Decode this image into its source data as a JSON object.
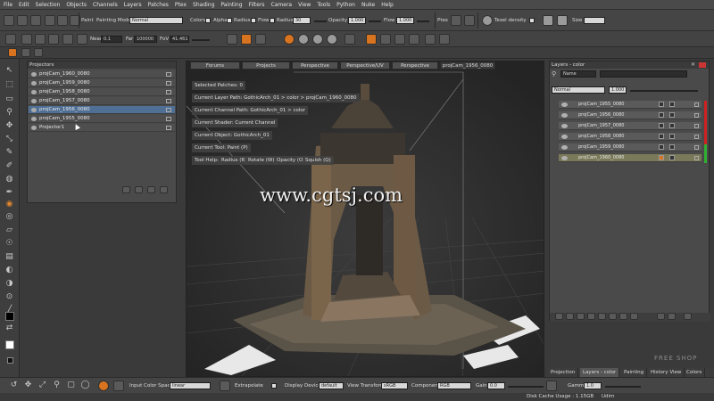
{
  "menu": [
    "File",
    "Edit",
    "Selection",
    "Objects",
    "Channels",
    "Layers",
    "Patches",
    "Ptex",
    "Shading",
    "Painting",
    "Filters",
    "Camera",
    "View",
    "Tools",
    "Python",
    "Nuke",
    "Help"
  ],
  "toolbar1": {
    "paint_label": "Paint",
    "painting_mode_label": "Painting Mode",
    "painting_mode_value": "Normal",
    "colors_label": "Colors",
    "alpha_label": "Alpha",
    "radius_label": "Radius",
    "flow_label": "Flow",
    "radius2_label": "Radius",
    "radius_value": "30",
    "opacity_label": "Opacity",
    "opacity_value": "1.000",
    "flow2_label": "Flow",
    "flow_value": "1.000",
    "ptex_label": "Ptex",
    "texel_density_label": "Texel density",
    "size_label": "Size"
  },
  "toolbar2": {
    "near_label": "Near",
    "near_value": "0.1",
    "far_label": "Far",
    "far_value": "100000",
    "fov_label": "FoV",
    "fov_value": "41.461"
  },
  "projectors": {
    "title": "Projectors",
    "items": [
      {
        "label": "projCam_1960_0080",
        "selected": false
      },
      {
        "label": "projCam_1959_0080",
        "selected": false
      },
      {
        "label": "projCam_1958_0080",
        "selected": false
      },
      {
        "label": "projCam_1957_0080",
        "selected": false
      },
      {
        "label": "projCam_1956_0080",
        "selected": true
      },
      {
        "label": "projCam_1955_0080",
        "selected": false
      },
      {
        "label": "Projector1",
        "selected": false
      }
    ]
  },
  "viewport": {
    "tabs": [
      "Forums",
      "Projects",
      "Perspective",
      "Perspective/UV",
      "Perspective",
      "projCam_1956_0080"
    ],
    "active_tab": 5,
    "info": {
      "selected_patches": "Selected Patches: 0",
      "layer_path": "Current Layer Path: GothicArch_01 > color > projCam_1960_0080",
      "channel_path": "Current Channel Path: GothicArch_01 > color",
      "shader": "Current Shader: Current Channel",
      "object": "Current Object: GothicArch_01",
      "tool": "Current Tool: Paint (P)",
      "tool_help": "Tool Help:",
      "radius_hint": "Radius (R)",
      "rotate_hint": "Rotate (W)",
      "opacity_hint": "Opacity (O)",
      "squish_hint": "Squish (Q)"
    },
    "watermark": "www.cgtsj.com"
  },
  "layers": {
    "title": "Layers - color",
    "filter_value": "Name",
    "blend_mode": "Normal",
    "opacity_value": "1.000",
    "items": [
      {
        "label": "projCam_1955_0080",
        "selected": false
      },
      {
        "label": "projCam_1956_0080",
        "selected": false
      },
      {
        "label": "projCam_1957_0080",
        "selected": false
      },
      {
        "label": "projCam_1958_0080",
        "selected": false
      },
      {
        "label": "projCam_1959_0080",
        "selected": false
      },
      {
        "label": "projCam_1960_0080",
        "selected": true
      }
    ]
  },
  "right_tabs": [
    "Projection",
    "Layers - color",
    "Painting",
    "History View",
    "Colors"
  ],
  "right_active_tab": 1,
  "bottombar": {
    "input_color_space_label": "Input Color Space",
    "input_color_space_value": "linear",
    "extrapolate_label": "Extrapolate",
    "display_device_label": "Display Device",
    "display_device_value": "default",
    "view_transform_label": "View Transform",
    "view_transform_value": "sRGB",
    "component_label": "Component",
    "component_value": "RGB",
    "gain_label": "Gain",
    "gain_value": "0.0",
    "gamma_label": "Gamma",
    "gamma_value": "1.0"
  },
  "status": {
    "disk_cache": "Disk Cache Usage : 1.15GB",
    "udim_label": "Udim"
  },
  "brand_watermark": "FREE SHOP",
  "colors": {
    "accent": "#d8741f",
    "selection": "#4f6f95",
    "background": "#3a3a3a"
  }
}
